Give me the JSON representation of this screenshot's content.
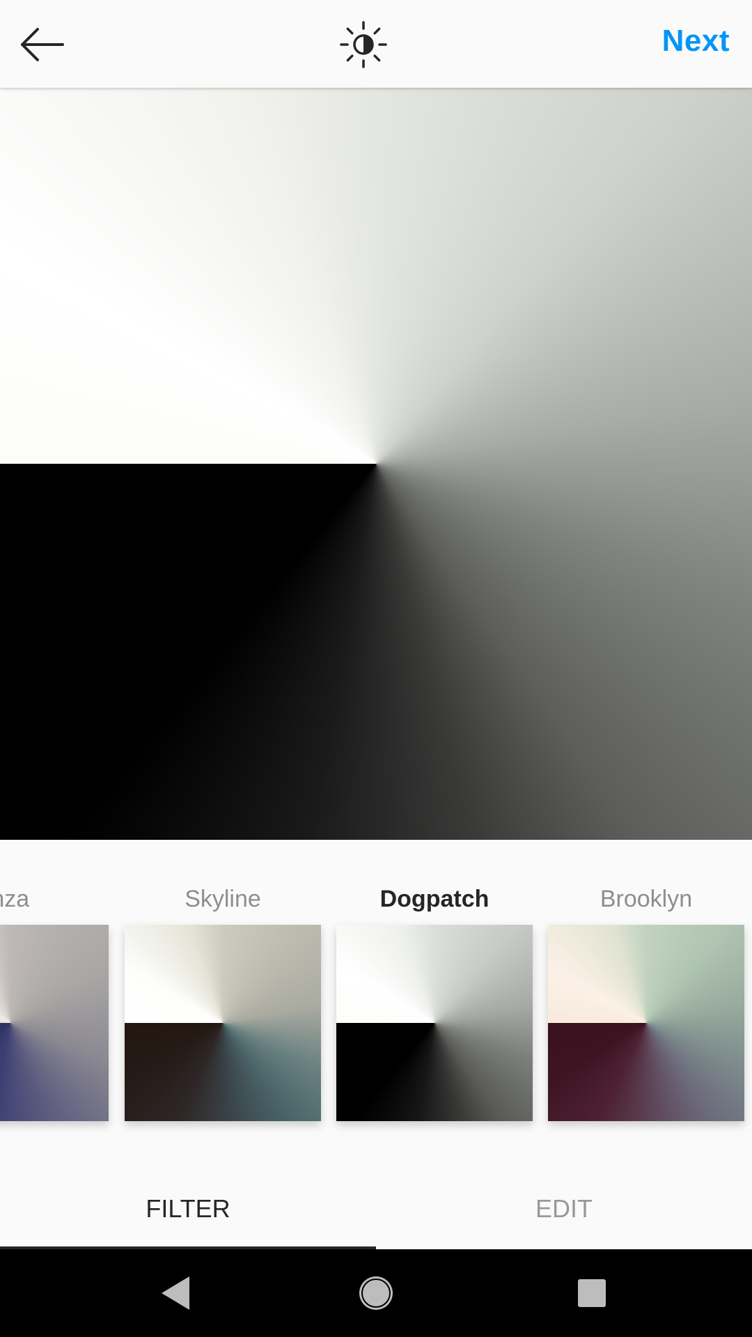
{
  "header": {
    "back_icon": "arrow-left-icon",
    "lux_icon": "sun-contrast-icon",
    "next_label": "Next",
    "accent_color": "#0095f6"
  },
  "filters": {
    "items": [
      {
        "label": "inza",
        "selected": false
      },
      {
        "label": "Skyline",
        "selected": false
      },
      {
        "label": "Dogpatch",
        "selected": true
      },
      {
        "label": "Brooklyn",
        "selected": false
      }
    ]
  },
  "tabs": {
    "items": [
      {
        "label": "FILTER",
        "active": true
      },
      {
        "label": "EDIT",
        "active": false
      }
    ]
  },
  "navbar": {
    "icons": [
      "nav-back-icon",
      "nav-home-icon",
      "nav-recents-icon"
    ]
  }
}
